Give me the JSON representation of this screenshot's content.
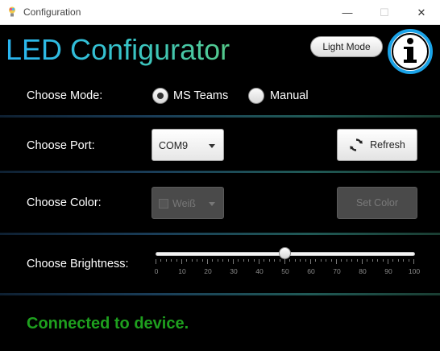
{
  "window": {
    "title": "Configuration"
  },
  "header": {
    "app_title": "LED Configurator",
    "light_mode_label": "Light Mode",
    "info_glyph": "i"
  },
  "mode": {
    "label": "Choose Mode:",
    "options": [
      "MS Teams",
      "Manual"
    ],
    "selected": "MS Teams"
  },
  "port": {
    "label": "Choose Port:",
    "selected": "COM9",
    "refresh_label": "Refresh"
  },
  "color": {
    "label": "Choose Color:",
    "selected": "Weiß",
    "set_color_label": "Set Color",
    "disabled": true
  },
  "brightness": {
    "label": "Choose Brightness:",
    "value": 50,
    "min": 0,
    "max": 100,
    "tick_labels": [
      "0",
      "10",
      "20",
      "30",
      "40",
      "50",
      "60",
      "70",
      "80",
      "90",
      "100"
    ]
  },
  "status": {
    "text": "Connected to device.",
    "color": "#1ea01e"
  },
  "colors": {
    "accent_blue": "#29b5f2",
    "accent_green": "#54c98a",
    "background": "#000000"
  },
  "icons": {
    "app": "lightbulb-icon",
    "info": "info-icon",
    "refresh": "refresh-icon"
  }
}
